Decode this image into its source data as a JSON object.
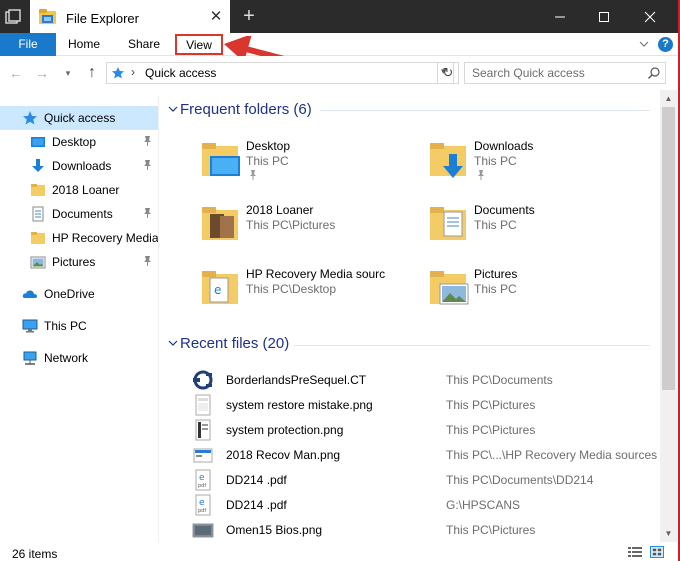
{
  "window": {
    "tab_title": "File Explorer",
    "close_tab_glyph": "✕",
    "new_tab_glyph": "+"
  },
  "ribbon": {
    "file": "File",
    "home": "Home",
    "share": "Share",
    "view": "View",
    "highlight_color": "#d9362f",
    "file_tab_color": "#1979ca"
  },
  "address": {
    "location": "Quick access",
    "search_placeholder": "Search Quick access"
  },
  "sidebar": {
    "items": [
      {
        "label": "Quick access",
        "icon": "star-icon",
        "selected": true
      },
      {
        "label": "Desktop",
        "icon": "desktop-icon",
        "pinned": true
      },
      {
        "label": "Downloads",
        "icon": "download-icon",
        "pinned": true
      },
      {
        "label": "2018 Loaner",
        "icon": "folder-icon"
      },
      {
        "label": "Documents",
        "icon": "documents-icon",
        "pinned": true
      },
      {
        "label": "HP Recovery Media",
        "icon": "folder-icon"
      },
      {
        "label": "Pictures",
        "icon": "pictures-icon",
        "pinned": true
      },
      {
        "label": "OneDrive",
        "icon": "cloud-icon"
      },
      {
        "label": "This PC",
        "icon": "computer-icon"
      },
      {
        "label": "Network",
        "icon": "network-icon"
      }
    ]
  },
  "frequent": {
    "heading": "Frequent folders (6)",
    "folders": [
      {
        "name": "Desktop",
        "location": "This PC",
        "pinned": true
      },
      {
        "name": "Downloads",
        "location": "This PC",
        "pinned": true
      },
      {
        "name": "2018 Loaner",
        "location": "This PC\\Pictures"
      },
      {
        "name": "Documents",
        "location": "This PC"
      },
      {
        "name": "HP Recovery Media sourc",
        "location": "This PC\\Desktop"
      },
      {
        "name": "Pictures",
        "location": "This PC"
      }
    ]
  },
  "recent": {
    "heading": "Recent files (20)",
    "files": [
      {
        "name": "BorderlandsPreSequel.CT",
        "location": "This PC\\Documents",
        "icon": "cheat-table-icon"
      },
      {
        "name": "system restore mistake.png",
        "location": "This PC\\Pictures",
        "icon": "image-file-icon"
      },
      {
        "name": "system protection.png",
        "location": "This PC\\Pictures",
        "icon": "image-file-icon"
      },
      {
        "name": "2018 Recov Man.png",
        "location": "This PC\\...\\HP Recovery Media sources",
        "icon": "image-file-icon"
      },
      {
        "name": "DD214 .pdf",
        "location": "This PC\\Documents\\DD214",
        "icon": "pdf-file-icon"
      },
      {
        "name": "DD214 .pdf",
        "location": "G:\\HPSCANS",
        "icon": "pdf-file-icon"
      },
      {
        "name": "Omen15 Bios.png",
        "location": "This PC\\Pictures",
        "icon": "image-file-icon"
      }
    ]
  },
  "status": {
    "item_count": "26 items"
  }
}
